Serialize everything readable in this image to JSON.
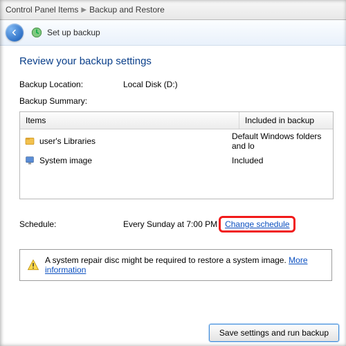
{
  "breadcrumb": {
    "prev": "Control Panel Items",
    "current": "Backup and Restore"
  },
  "toolbar": {
    "title": "Set up backup"
  },
  "page": {
    "title": "Review your backup settings"
  },
  "location": {
    "label": "Backup Location:",
    "value": "Local Disk (D:)"
  },
  "summary": {
    "label": "Backup Summary:"
  },
  "grid": {
    "columns": {
      "items": "Items",
      "included": "Included in backup"
    },
    "rows": [
      {
        "icon": "libraries-icon",
        "item": "user's Libraries",
        "included": "Default Windows folders and lo"
      },
      {
        "icon": "system-image-icon",
        "item": "System image",
        "included": "Included"
      }
    ]
  },
  "schedule": {
    "label": "Schedule:",
    "value": "Every Sunday at 7:00 PM",
    "change_link": "Change schedule"
  },
  "notice": {
    "text": "A system repair disc might be required to restore a system image. ",
    "more_link": "More information"
  },
  "footer": {
    "primary": "Save settings and run backup"
  }
}
